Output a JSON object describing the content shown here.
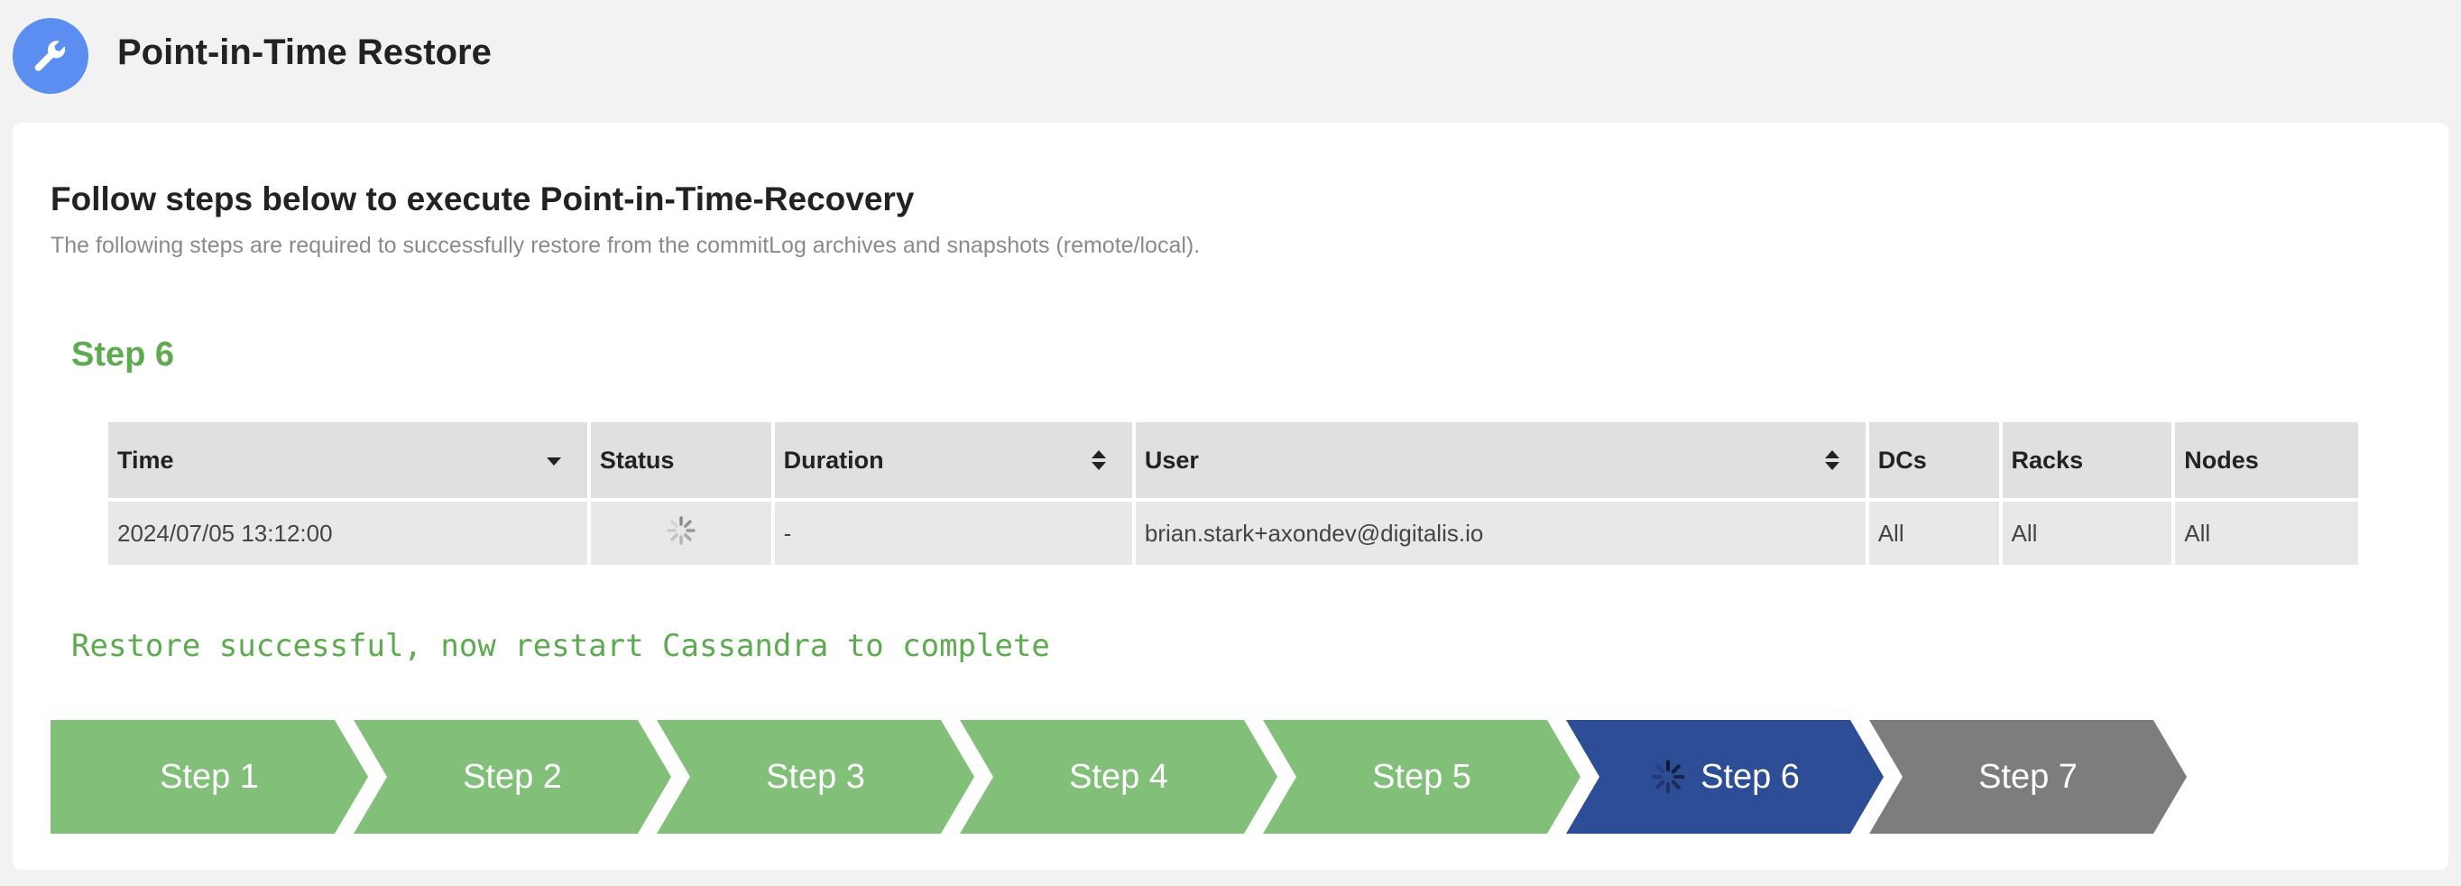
{
  "header": {
    "title": "Point-in-Time Restore",
    "icon": "wrench-icon",
    "icon_bg": "#5b8ef0"
  },
  "intro": {
    "title": "Follow steps below to execute Point-in-Time-Recovery",
    "description": "The following steps are required to successfully restore from the commitLog archives and snapshots (remote/local)."
  },
  "current_step": {
    "heading": "Step 6"
  },
  "table": {
    "columns": [
      "Time",
      "Status",
      "Duration",
      "User",
      "DCs",
      "Racks",
      "Nodes"
    ],
    "rows": [
      {
        "time": "2024/07/05 13:12:00",
        "status": "loading",
        "duration": "-",
        "user": "brian.stark+axondev@digitalis.io",
        "dcs": "All",
        "racks": "All",
        "nodes": "All"
      }
    ]
  },
  "message": "Restore successful, now restart Cassandra to complete",
  "steps": [
    {
      "label": "Step 1",
      "state": "done"
    },
    {
      "label": "Step 2",
      "state": "done"
    },
    {
      "label": "Step 3",
      "state": "done"
    },
    {
      "label": "Step 4",
      "state": "done"
    },
    {
      "label": "Step 5",
      "state": "done"
    },
    {
      "label": "Step 6",
      "state": "active"
    },
    {
      "label": "Step 7",
      "state": "pending"
    }
  ],
  "colors": {
    "success": "#5cab4e",
    "step_done": "#82bf78",
    "step_active": "#2d4d96",
    "step_pending": "#7d7d7d"
  }
}
